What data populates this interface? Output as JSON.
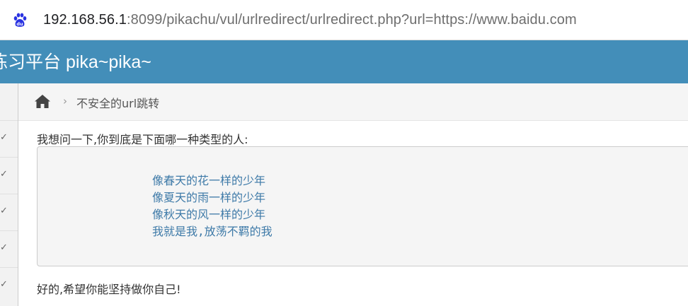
{
  "browser": {
    "url_host": "192.168.56.1",
    "url_rest": ":8099/pikachu/vul/urlredirect/urlredirect.php?url=https://www.baidu.com",
    "favicon": "baidu-paw-icon",
    "favicon_color": "#2932e1"
  },
  "header": {
    "brand": "练习平台 pika~pika~",
    "color": "#438eb9"
  },
  "sidebar": {
    "items": [
      {
        "icon": "check-icon",
        "glyph": "✓"
      },
      {
        "icon": "check-icon",
        "glyph": "✓"
      },
      {
        "icon": "check-icon",
        "glyph": "✓"
      },
      {
        "icon": "check-icon",
        "glyph": "✓"
      },
      {
        "icon": "check-icon",
        "glyph": "✓"
      }
    ]
  },
  "breadcrumb": {
    "home_icon": "home-icon",
    "separator": "›",
    "current": "不安全的url跳转"
  },
  "content": {
    "question": "我想问一下,你到底是下面哪一种类型的人:",
    "options": [
      "像春天的花一样的少年",
      "像夏天的雨一样的少年",
      "像秋天的风一样的少年",
      "我就是我,放荡不羁的我"
    ],
    "answer": "好的,希望你能坚持做你自己!",
    "option_color": "#3e7aa8"
  }
}
